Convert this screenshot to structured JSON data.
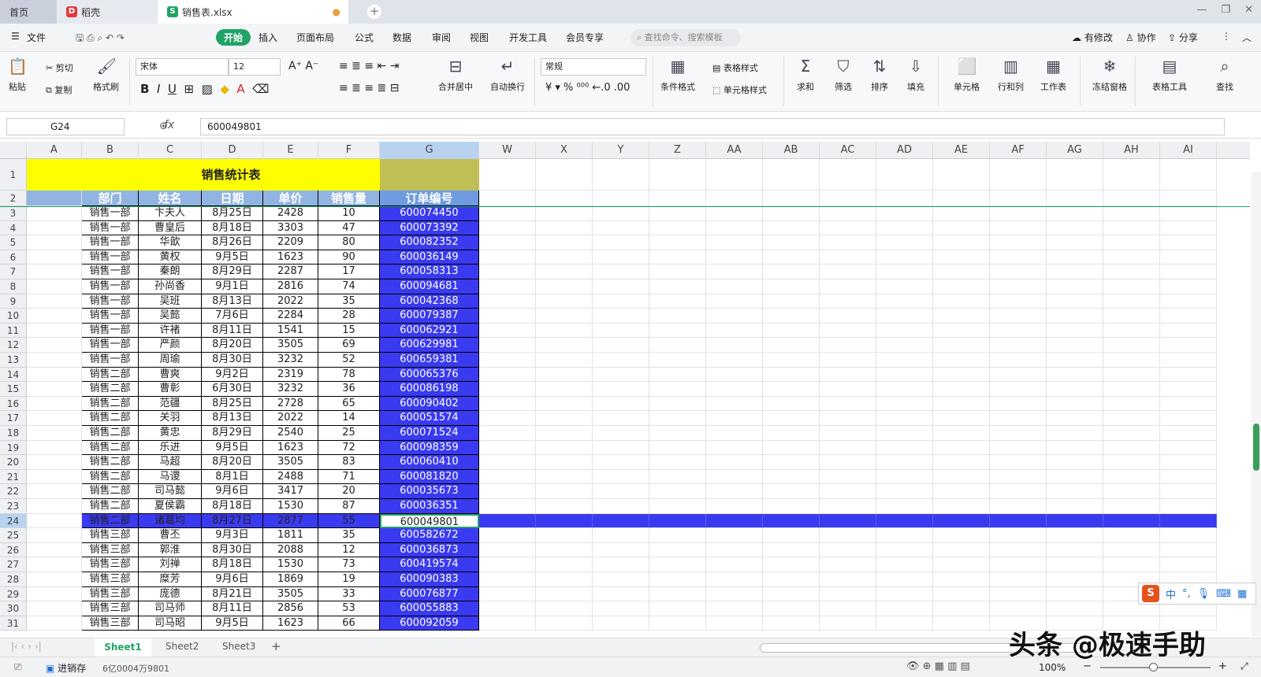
{
  "tabs": {
    "home": "首页",
    "docer": "稻壳",
    "file": "销售表.xlsx"
  },
  "menu": {
    "file": "文件",
    "start": "开始",
    "insert": "插入",
    "layout": "页面布局",
    "formula": "公式",
    "data": "数据",
    "review": "审阅",
    "view": "视图",
    "dev": "开发工具",
    "vip": "会员专享",
    "search": "查找命令、搜索模板",
    "modified": "有修改",
    "collab": "协作",
    "share": "分享"
  },
  "ribbon": {
    "paste": "粘贴",
    "cut": "剪切",
    "copy": "复制",
    "painter": "格式刷",
    "font": "宋体",
    "size": "12",
    "merge": "合并居中",
    "wrap": "自动换行",
    "numfmt": "常规",
    "cond": "条件格式",
    "tablestyle": "表格样式",
    "cellstyle": "单元格样式",
    "sum": "求和",
    "filter": "筛选",
    "sort": "排序",
    "fill": "填充",
    "cells": "单元格",
    "rowcol": "行和列",
    "sheet": "工作表",
    "freeze": "冻结窗格",
    "tabletools": "表格工具",
    "find": "查找"
  },
  "namebox": "G24",
  "formula": "600049801",
  "columns": [
    "A",
    "B",
    "C",
    "D",
    "E",
    "F",
    "G",
    "W",
    "X",
    "Y",
    "Z",
    "AA",
    "AB",
    "AC",
    "AD",
    "AE",
    "AF",
    "AG",
    "AH",
    "AI"
  ],
  "title": "销售统计表",
  "headers": [
    "部门",
    "姓名",
    "日期",
    "单价",
    "销售量",
    "订单编号"
  ],
  "rows": [
    [
      "销售一部",
      "卞夫人",
      "8月25日",
      "2428",
      "10",
      "600074450"
    ],
    [
      "销售一部",
      "曹皇后",
      "8月18日",
      "3303",
      "47",
      "600073392"
    ],
    [
      "销售一部",
      "华歆",
      "8月26日",
      "2209",
      "80",
      "600082352"
    ],
    [
      "销售一部",
      "黄权",
      "9月5日",
      "1623",
      "90",
      "600036149"
    ],
    [
      "销售一部",
      "秦朗",
      "8月29日",
      "2287",
      "17",
      "600058313"
    ],
    [
      "销售一部",
      "孙尚香",
      "9月1日",
      "2816",
      "74",
      "600094681"
    ],
    [
      "销售一部",
      "吴班",
      "8月13日",
      "2022",
      "35",
      "600042368"
    ],
    [
      "销售一部",
      "吴懿",
      "7月6日",
      "2284",
      "28",
      "600079387"
    ],
    [
      "销售一部",
      "许褚",
      "8月11日",
      "1541",
      "15",
      "600062921"
    ],
    [
      "销售一部",
      "严颜",
      "8月20日",
      "3505",
      "69",
      "600629981"
    ],
    [
      "销售一部",
      "周瑜",
      "8月30日",
      "3232",
      "52",
      "600659381"
    ],
    [
      "销售二部",
      "曹爽",
      "9月2日",
      "2319",
      "78",
      "600065376"
    ],
    [
      "销售二部",
      "曹彰",
      "6月30日",
      "3232",
      "36",
      "600086198"
    ],
    [
      "销售二部",
      "范疆",
      "8月25日",
      "2728",
      "65",
      "600090402"
    ],
    [
      "销售二部",
      "关羽",
      "8月13日",
      "2022",
      "14",
      "600051574"
    ],
    [
      "销售二部",
      "黄忠",
      "8月29日",
      "2540",
      "25",
      "600071524"
    ],
    [
      "销售二部",
      "乐进",
      "9月5日",
      "1623",
      "72",
      "600098359"
    ],
    [
      "销售二部",
      "马超",
      "8月20日",
      "3505",
      "83",
      "600060410"
    ],
    [
      "销售二部",
      "马谡",
      "8月1日",
      "2488",
      "71",
      "600081820"
    ],
    [
      "销售二部",
      "司马懿",
      "9月6日",
      "3417",
      "20",
      "600035673"
    ],
    [
      "销售二部",
      "夏侯霸",
      "8月18日",
      "1530",
      "87",
      "600036351"
    ],
    [
      "销售二部",
      "诸葛均",
      "8月27日",
      "2877",
      "55",
      "600049801"
    ],
    [
      "销售三部",
      "曹丕",
      "9月3日",
      "1811",
      "35",
      "600582672"
    ],
    [
      "销售三部",
      "郭淮",
      "8月30日",
      "2088",
      "12",
      "600036873"
    ],
    [
      "销售三部",
      "刘禅",
      "8月18日",
      "1530",
      "73",
      "600419574"
    ],
    [
      "销售三部",
      "糜芳",
      "9月6日",
      "1869",
      "19",
      "600090383"
    ],
    [
      "销售三部",
      "庞德",
      "8月21日",
      "3505",
      "33",
      "600076877"
    ],
    [
      "销售三部",
      "司马师",
      "8月11日",
      "2856",
      "53",
      "600055883"
    ],
    [
      "销售三部",
      "司马昭",
      "9月5日",
      "1623",
      "66",
      "600092059"
    ]
  ],
  "row_numbers": [
    "1",
    "2",
    "3",
    "4",
    "5",
    "6",
    "7",
    "8",
    "9",
    "10",
    "11",
    "12",
    "13",
    "14",
    "15",
    "16",
    "17",
    "18",
    "19",
    "20",
    "21",
    "22",
    "23",
    "24",
    "25",
    "26",
    "27",
    "28",
    "29",
    "30",
    "31"
  ],
  "sheets": [
    "Sheet1",
    "Sheet2",
    "Sheet3"
  ],
  "status": {
    "inventory": "进销存",
    "value": "6亿0004万9801",
    "zoom": "100%"
  },
  "ime": "中",
  "watermark": "头条 @极速手助",
  "colors": {
    "yellow": "#ffff00",
    "olive": "#c0bf56",
    "header_bg": "#92b4e3",
    "blue": "#3a3af0",
    "green": "#21a366"
  }
}
